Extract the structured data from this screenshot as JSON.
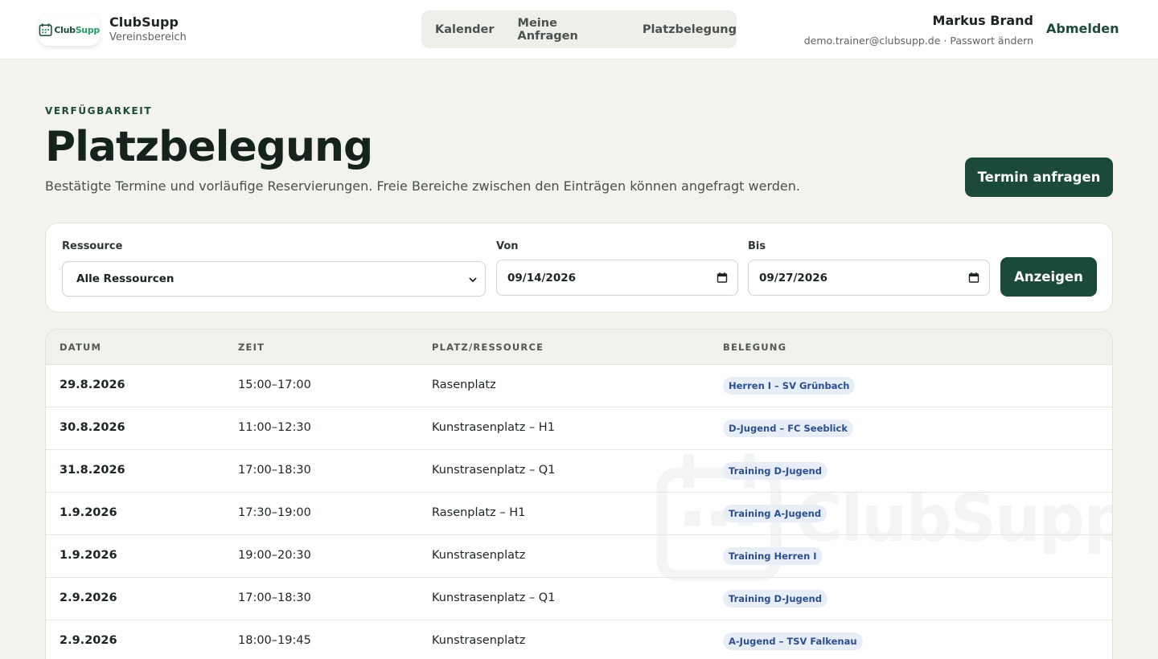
{
  "header": {
    "logo_text_1": "Club",
    "logo_text_2": "Supp",
    "brand_name": "ClubSupp",
    "brand_sub": "Vereinsbereich",
    "nav": [
      {
        "label": "Kalender"
      },
      {
        "label": "Meine Anfragen"
      },
      {
        "label": "Platzbelegung"
      }
    ],
    "user_name": "Markus Brand",
    "user_email": "demo.trainer@clubsupp.de",
    "separator": "·",
    "change_password": "Passwort ändern",
    "logout": "Abmelden"
  },
  "page": {
    "eyebrow": "VERFÜGBARKEIT",
    "title": "Platzbelegung",
    "description": "Bestätigte Termine und vorläufige Reservierungen. Freie Bereiche zwischen den Einträgen können angefragt werden.",
    "request_button": "Termin anfragen"
  },
  "filter": {
    "resource_label": "Ressource",
    "resource_value": "Alle Ressourcen",
    "from_label": "Von",
    "from_value": "09/14/2026",
    "to_label": "Bis",
    "to_value": "09/27/2026",
    "show_button": "Anzeigen"
  },
  "table": {
    "columns": [
      "DATUM",
      "ZEIT",
      "PLATZ/RESSOURCE",
      "BELEGUNG"
    ],
    "rows": [
      {
        "date": "29.8.2026",
        "time": "15:00–17:00",
        "resource": "Rasenplatz",
        "booking": "Herren I – SV Grünbach"
      },
      {
        "date": "30.8.2026",
        "time": "11:00–12:30",
        "resource": "Kunstrasenplatz – H1",
        "booking": "D-Jugend – FC Seeblick"
      },
      {
        "date": "31.8.2026",
        "time": "17:00–18:30",
        "resource": "Kunstrasenplatz – Q1",
        "booking": "Training D-Jugend"
      },
      {
        "date": "1.9.2026",
        "time": "17:30–19:00",
        "resource": "Rasenplatz – H1",
        "booking": "Training A-Jugend"
      },
      {
        "date": "1.9.2026",
        "time": "19:00–20:30",
        "resource": "Kunstrasenplatz",
        "booking": "Training Herren I"
      },
      {
        "date": "2.9.2026",
        "time": "17:00–18:30",
        "resource": "Kunstrasenplatz – Q1",
        "booking": "Training D-Jugend"
      },
      {
        "date": "2.9.2026",
        "time": "18:00–19:45",
        "resource": "Kunstrasenplatz",
        "booking": "A-Jugend – TSV Falkenau"
      }
    ]
  },
  "colors": {
    "brand": "#1c4a3a",
    "background": "#f3f3ee",
    "badge_bg": "#e8eef8",
    "badge_text": "#2c4f8e"
  },
  "icons": {
    "logo": "calendar-icon",
    "select": "chevron-down-icon",
    "date": "calendar-icon"
  }
}
